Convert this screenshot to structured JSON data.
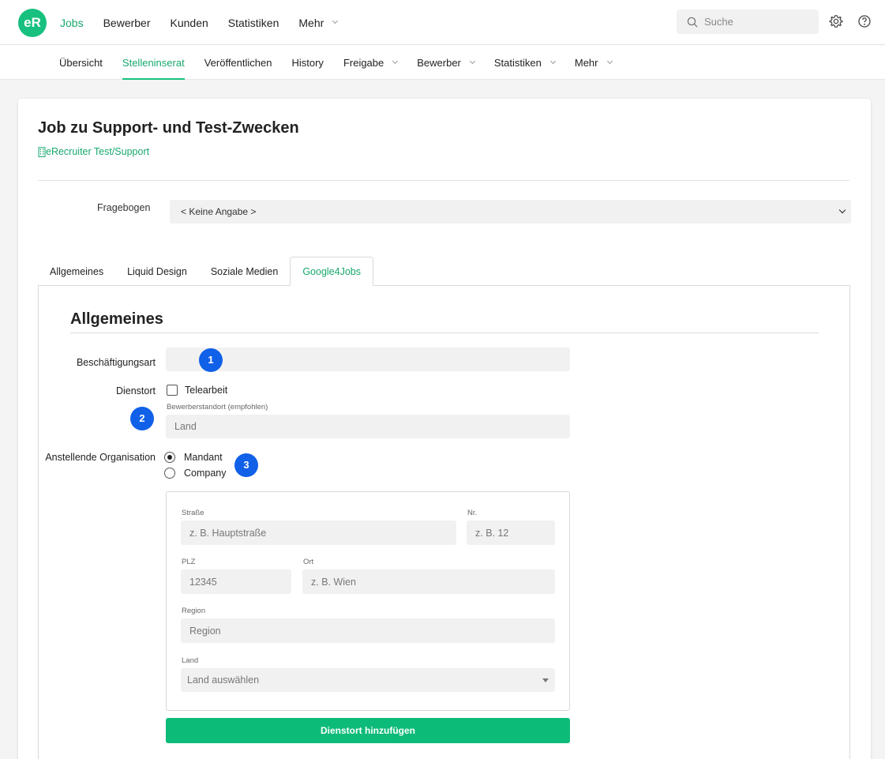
{
  "app": {
    "logo_text": "eR"
  },
  "topnav": {
    "items": [
      {
        "label": "Jobs",
        "active": true
      },
      {
        "label": "Bewerber"
      },
      {
        "label": "Kunden"
      },
      {
        "label": "Statistiken"
      },
      {
        "label": "Mehr"
      }
    ],
    "search_placeholder": "Suche",
    "icons": [
      "search-icon",
      "gear-icon",
      "help-icon"
    ]
  },
  "subnav": {
    "items": [
      {
        "label": "Übersicht"
      },
      {
        "label": "Stelleninserat",
        "active": true
      },
      {
        "label": "Veröffentlichen"
      },
      {
        "label": "History"
      },
      {
        "label": "Freigabe"
      },
      {
        "label": "Bewerber"
      },
      {
        "label": "Statistiken"
      },
      {
        "label": "Mehr"
      }
    ]
  },
  "job": {
    "title": "Job zu Support- und Test-Zwecken",
    "company": "eRecruiter Test/Support"
  },
  "fragebogen": {
    "label": "Fragebogen",
    "value": "< Keine Angabe >"
  },
  "tabs": [
    {
      "label": "Allgemeines"
    },
    {
      "label": "Liquid Design"
    },
    {
      "label": "Soziale Medien"
    },
    {
      "label": "Google4Jobs",
      "active": true
    }
  ],
  "section": {
    "title": "Allgemeines",
    "beschaeftigungsart": {
      "label": "Beschäftigungsart",
      "value": ""
    },
    "dienstort": {
      "label": "Dienstort",
      "telearbeit_label": "Telearbeit",
      "telearbeit_checked": false,
      "bewerberstandort_label": "Bewerberstandort (empfohlen)",
      "bewerberstandort_placeholder": "Land"
    },
    "organisation": {
      "label": "Anstellende Organisation",
      "options": [
        {
          "label": "Mandant",
          "selected": true
        },
        {
          "label": "Company",
          "selected": false
        }
      ]
    },
    "address": {
      "strasse": {
        "label": "Straße",
        "placeholder": "z. B. Hauptstraße"
      },
      "nr": {
        "label": "Nr.",
        "placeholder": "z. B. 12"
      },
      "plz": {
        "label": "PLZ",
        "placeholder": "12345"
      },
      "ort": {
        "label": "Ort",
        "placeholder": "z. B. Wien"
      },
      "region": {
        "label": "Region",
        "placeholder": "Region"
      },
      "land": {
        "label": "Land",
        "value": "Land auswählen"
      }
    },
    "add_button": "Dienstort hinzufügen"
  },
  "badges": [
    "1",
    "2",
    "3"
  ],
  "colors": {
    "accent": "#17c07e",
    "accent_text": "#17a86f",
    "badge": "#1060e8",
    "button": "#0cbb78"
  }
}
